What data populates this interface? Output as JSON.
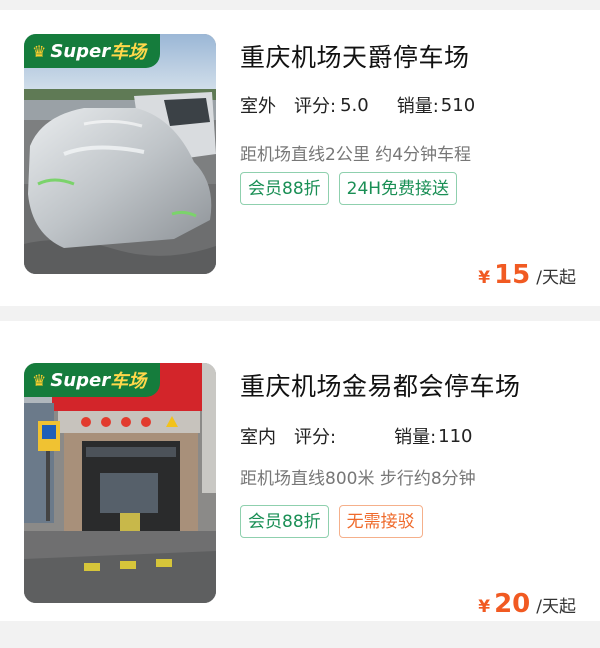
{
  "listings": [
    {
      "badge_text": "Super",
      "badge_text2": "车场",
      "title": "重庆机场天爵停车场",
      "kind": "室外",
      "rating_label": "评分:",
      "rating_value": "5.0",
      "sales_label": "销量:",
      "sales_value": "510",
      "distance": "距机场直线2公里 约4分钟车程",
      "tags": [
        "会员88折",
        "24H免费接送"
      ],
      "currency": "¥",
      "price": "15",
      "price_unit": "/天起"
    },
    {
      "badge_text": "Super",
      "badge_text2": "车场",
      "title": "重庆机场金易都会停车场",
      "kind": "室内",
      "rating_label": "评分:",
      "rating_value": "",
      "sales_label": "销量:",
      "sales_value": "110",
      "distance": "距机场直线800米 步行约8分钟",
      "tags": [
        "会员88折",
        "无需接驳"
      ],
      "currency": "¥",
      "price": "20",
      "price_unit": "/天起"
    }
  ],
  "colors": {
    "badge_green": "#157c3c",
    "badge_word": "#ffd84a",
    "tag_green": "#1a8f55",
    "tag_orange": "#ef6a2b",
    "price": "#f15a22"
  },
  "icons": [
    "crown-icon"
  ]
}
